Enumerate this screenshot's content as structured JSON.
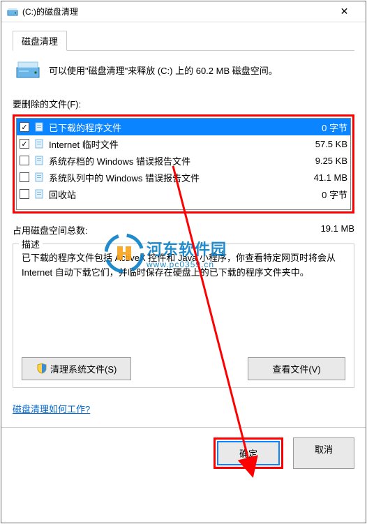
{
  "title": "(C:)的磁盘清理",
  "tab": "磁盘清理",
  "info_text": "可以使用\"磁盘清理\"来释放  (C:) 上的 60.2 MB 磁盘空间。",
  "files_label": "要删除的文件(F):",
  "rows": [
    {
      "checked": true,
      "selected": true,
      "name": "已下载的程序文件",
      "size": "0 字节"
    },
    {
      "checked": true,
      "selected": false,
      "name": "Internet 临时文件",
      "size": "57.5 KB"
    },
    {
      "checked": false,
      "selected": false,
      "name": "系统存档的 Windows 错误报告文件",
      "size": "9.25 KB"
    },
    {
      "checked": false,
      "selected": false,
      "name": "系统队列中的 Windows 错误报告文件",
      "size": "41.1 MB"
    },
    {
      "checked": false,
      "selected": false,
      "name": "回收站",
      "size": "0 字节"
    }
  ],
  "total_label": "占用磁盘空间总数:",
  "total_value": "19.1 MB",
  "desc_legend": "描述",
  "desc_text": "已下载的程序文件包括 ActiveX 控件和 Java 小程序，你查看特定网页时将会从 Internet 自动下载它们，并临时保存在硬盘上的已下载的程序文件夹中。",
  "btn_clean": "清理系统文件(S)",
  "btn_view": "查看文件(V)",
  "link": "磁盘清理如何工作?",
  "btn_ok": "确定",
  "btn_cancel": "取消",
  "watermark_text": "河东软件园",
  "watermark_url": "www.pc0359.cn"
}
